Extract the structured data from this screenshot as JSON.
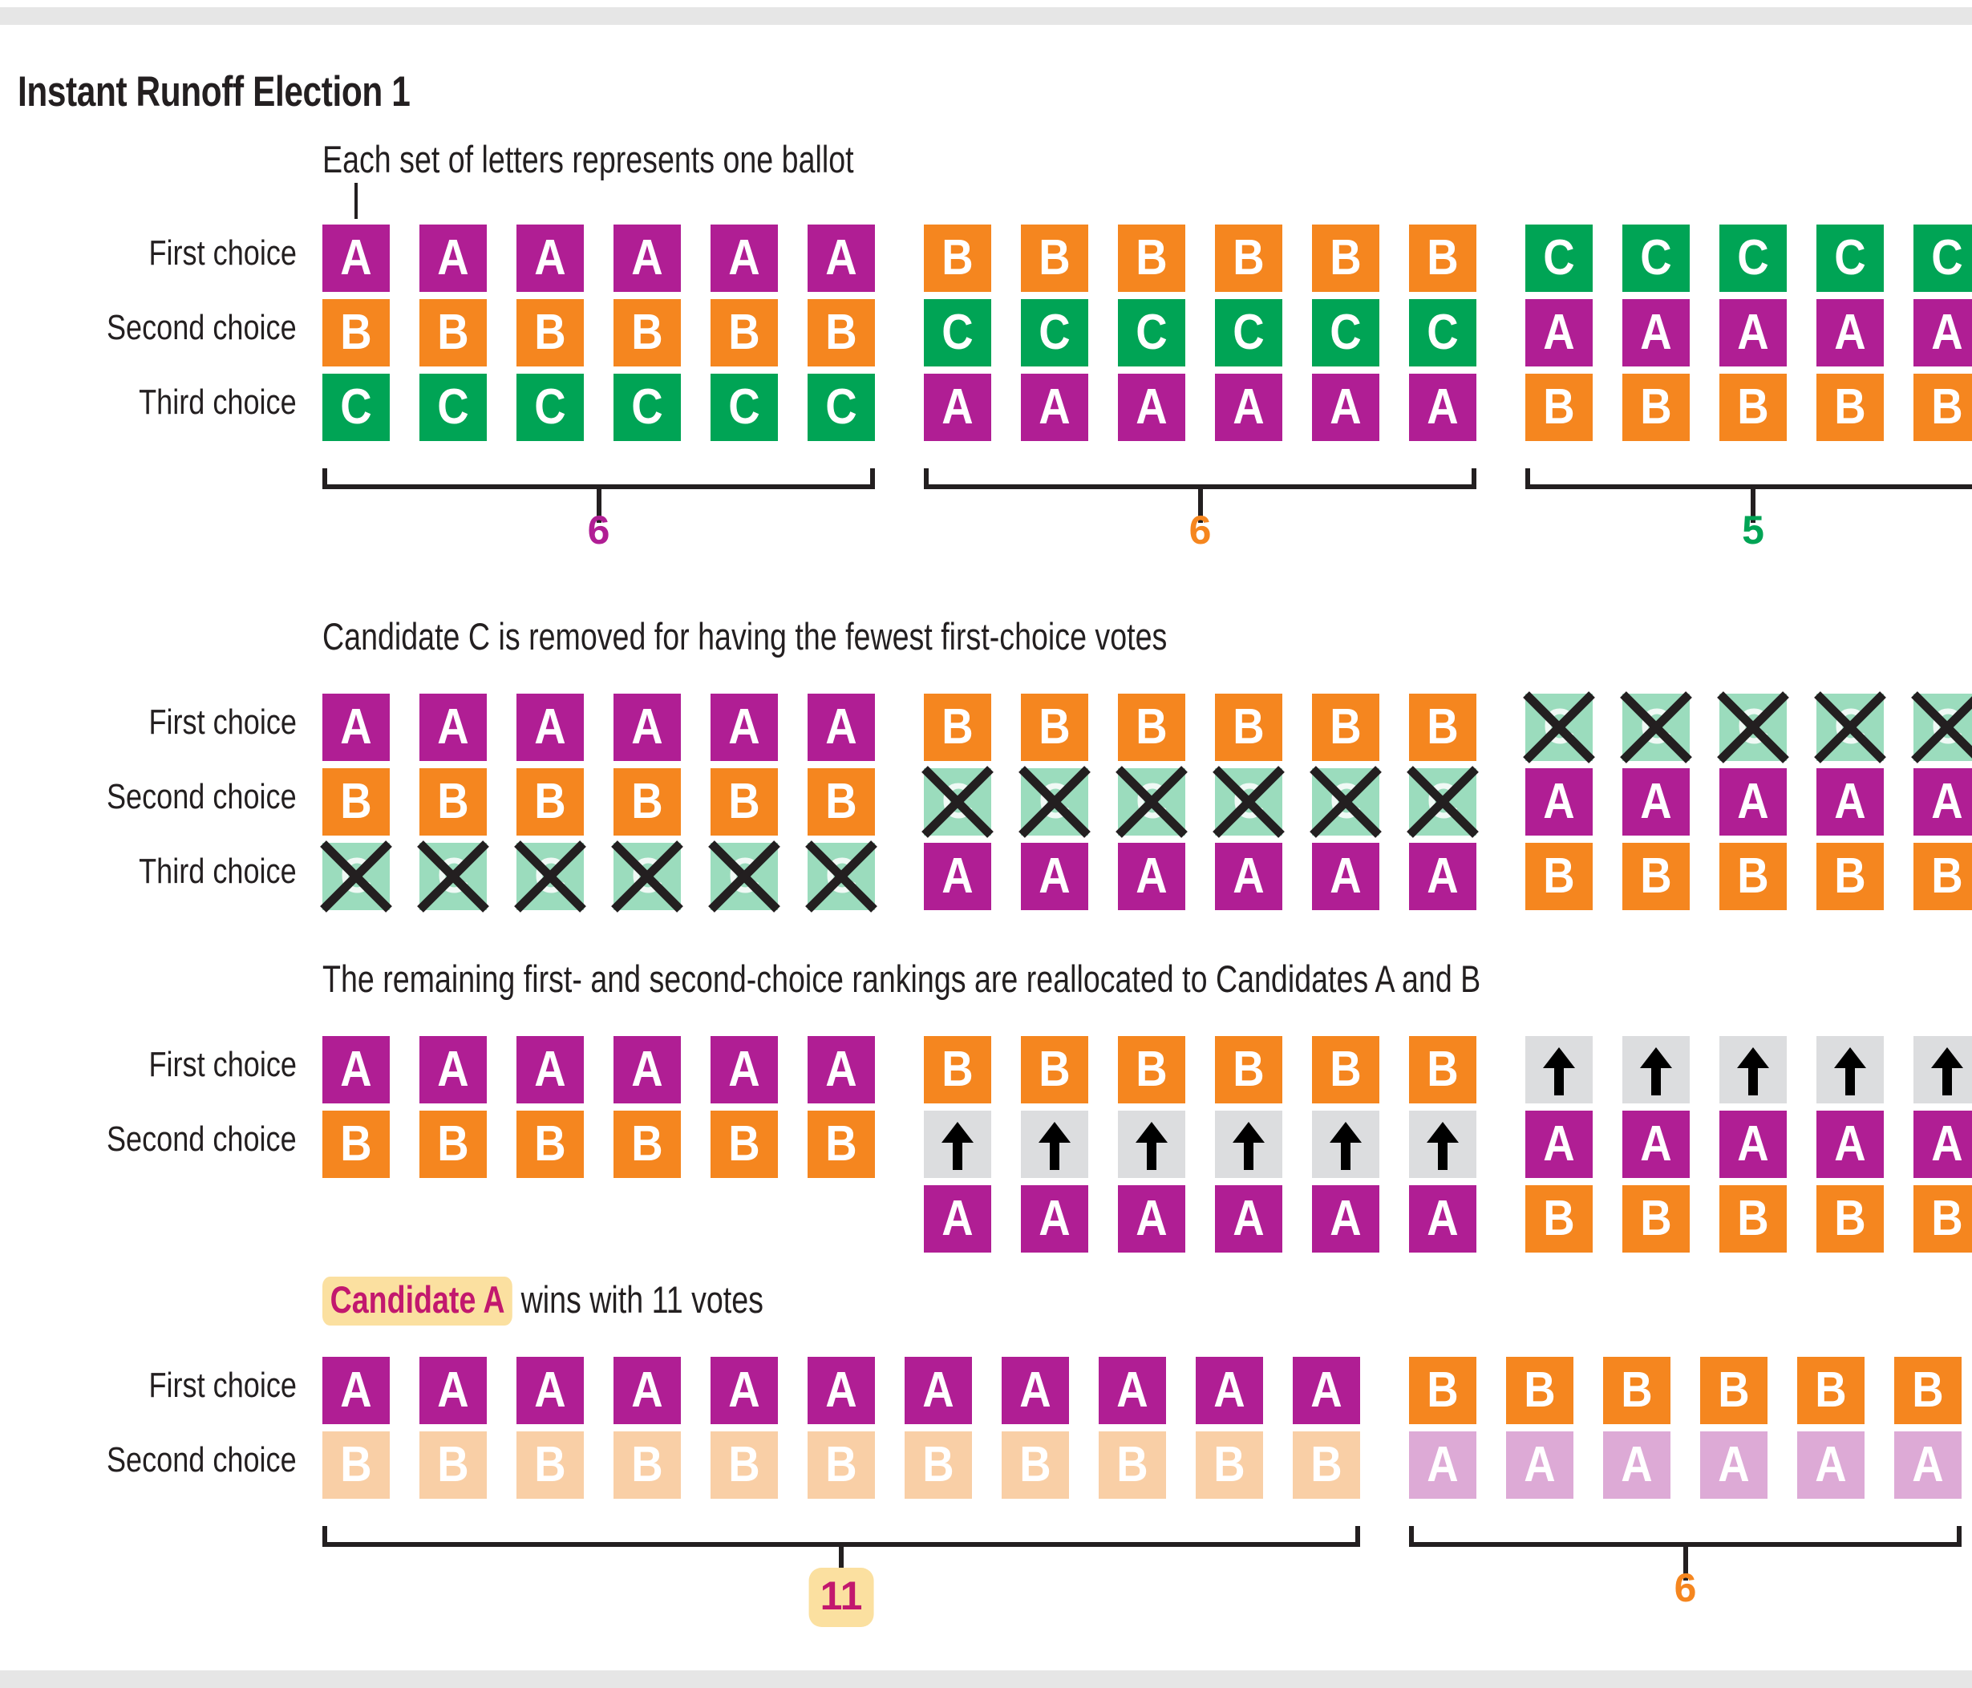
{
  "page": {
    "title": "Instant Runoff Election 1",
    "accent_colors": {
      "candidate_a": "#b01e94",
      "candidate_b": "#f5861f",
      "candidate_c": "#00a455",
      "candidate_a_faded": "#ddaad6",
      "candidate_b_faded": "#f9cfa6",
      "candidate_c_eliminated": "#9bdcbd",
      "reallocation": "#dcdddf",
      "highlight": "#fbe0a0",
      "ink": "#231f20"
    }
  },
  "chart_data": {
    "type": "table",
    "title": "Instant Runoff Election 1",
    "description": "Ranked-choice instant runoff walkthrough. Each column of letters is one ballot; rows are ranked preferences.",
    "candidates": [
      "A",
      "B",
      "C"
    ],
    "rounds": [
      {
        "caption": "Each set of letters represents one ballot",
        "pointer_note": "line pointing from caption to first ballot",
        "row_labels": [
          "First choice",
          "Second choice",
          "Third choice"
        ],
        "groups": [
          {
            "ballot": [
              "A",
              "B",
              "C"
            ],
            "count": 6,
            "count_color": "#b01e94",
            "tiles": [
              [
                "A",
                "A",
                "A",
                "A",
                "A",
                "A"
              ],
              [
                "B",
                "B",
                "B",
                "B",
                "B",
                "B"
              ],
              [
                "C",
                "C",
                "C",
                "C",
                "C",
                "C"
              ]
            ]
          },
          {
            "ballot": [
              "B",
              "C",
              "A"
            ],
            "count": 6,
            "count_color": "#f5861f",
            "tiles": [
              [
                "B",
                "B",
                "B",
                "B",
                "B",
                "B"
              ],
              [
                "C",
                "C",
                "C",
                "C",
                "C",
                "C"
              ],
              [
                "A",
                "A",
                "A",
                "A",
                "A",
                "A"
              ]
            ]
          },
          {
            "ballot": [
              "C",
              "A",
              "B"
            ],
            "count": 5,
            "count_color": "#00a455",
            "tiles": [
              [
                "C",
                "C",
                "C",
                "C",
                "C"
              ],
              [
                "A",
                "A",
                "A",
                "A",
                "A"
              ],
              [
                "B",
                "B",
                "B",
                "B",
                "B"
              ]
            ]
          }
        ]
      },
      {
        "caption": "Candidate C is removed for having the fewest first-choice votes",
        "row_labels": [
          "First choice",
          "Second choice",
          "Third choice"
        ],
        "groups": [
          {
            "count": 6,
            "tiles": [
              [
                "A",
                "A",
                "A",
                "A",
                "A",
                "A"
              ],
              [
                "B",
                "B",
                "B",
                "B",
                "B",
                "B"
              ],
              [
                "X",
                "X",
                "X",
                "X",
                "X",
                "X"
              ]
            ]
          },
          {
            "count": 6,
            "tiles": [
              [
                "B",
                "B",
                "B",
                "B",
                "B",
                "B"
              ],
              [
                "X",
                "X",
                "X",
                "X",
                "X",
                "X"
              ],
              [
                "A",
                "A",
                "A",
                "A",
                "A",
                "A"
              ]
            ]
          },
          {
            "count": 5,
            "tiles": [
              [
                "X",
                "X",
                "X",
                "X",
                "X"
              ],
              [
                "A",
                "A",
                "A",
                "A",
                "A"
              ],
              [
                "B",
                "B",
                "B",
                "B",
                "B"
              ]
            ]
          }
        ]
      },
      {
        "caption": "The remaining first- and second-choice rankings are reallocated to Candidates A and B",
        "row_labels": [
          "First choice",
          "Second choice"
        ],
        "groups": [
          {
            "count": 6,
            "tiles": [
              [
                "A",
                "A",
                "A",
                "A",
                "A",
                "A"
              ],
              [
                "B",
                "B",
                "B",
                "B",
                "B",
                "B"
              ],
              [
                "",
                "",
                "",
                "",
                "",
                ""
              ]
            ]
          },
          {
            "count": 6,
            "tiles": [
              [
                "B",
                "B",
                "B",
                "B",
                "B",
                "B"
              ],
              [
                "^",
                "^",
                "^",
                "^",
                "^",
                "^"
              ],
              [
                "A",
                "A",
                "A",
                "A",
                "A",
                "A"
              ]
            ]
          },
          {
            "count": 5,
            "tiles": [
              [
                "^",
                "^",
                "^",
                "^",
                "^"
              ],
              [
                "A",
                "A",
                "A",
                "A",
                "A"
              ],
              [
                "B",
                "B",
                "B",
                "B",
                "B"
              ]
            ]
          }
        ]
      },
      {
        "caption_highlight": "Candidate A",
        "caption_rest": " wins with 11 votes",
        "row_labels": [
          "First choice",
          "Second choice"
        ],
        "result_groups": [
          {
            "winner": "A",
            "count": 11,
            "count_color": "#c2186e",
            "count_badge": true,
            "first_choice": [
              "A",
              "A",
              "A",
              "A",
              "A",
              "A",
              "A",
              "A",
              "A",
              "A",
              "A"
            ],
            "second_choice": [
              "B",
              "B",
              "B",
              "B",
              "B",
              "B",
              "B",
              "B",
              "B",
              "B",
              "B"
            ]
          },
          {
            "winner": "B",
            "count": 6,
            "count_color": "#f5861f",
            "count_badge": false,
            "first_choice": [
              "B",
              "B",
              "B",
              "B",
              "B",
              "B"
            ],
            "second_choice": [
              "A",
              "A",
              "A",
              "A",
              "A",
              "A"
            ]
          }
        ]
      }
    ]
  }
}
